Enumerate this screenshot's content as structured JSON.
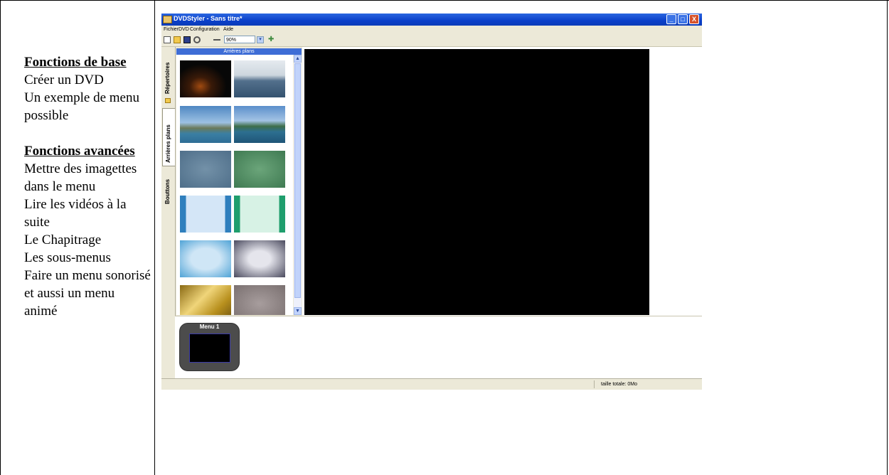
{
  "document": {
    "sections": [
      {
        "heading": "Fonctions de base",
        "items": [
          "Créer un DVD",
          "Un exemple de menu possible"
        ]
      },
      {
        "heading": "Fonctions avancées",
        "items": [
          "Mettre des imagettes dans le menu",
          "Lire les vidéos à la suite",
          "Le Chapitrage",
          "Les sous-menus",
          "Faire un menu sonorisé et aussi un menu animé"
        ]
      }
    ]
  },
  "window": {
    "title": "DVDStyler - Sans titre*",
    "controls": {
      "minimize": "_",
      "maximize": "□",
      "close": "X"
    }
  },
  "menubar": {
    "items": [
      "Fichier",
      "DVD",
      "Configuration",
      "Aide"
    ]
  },
  "toolbar": {
    "icons": [
      "new-icon",
      "open-icon",
      "save-icon",
      "settings-icon",
      "minus-icon",
      "zoom-in-icon"
    ],
    "zoom": "90%"
  },
  "side_tabs": [
    "Répertoires",
    "Arrières plans",
    "Bouttons"
  ],
  "panel": {
    "header": "Arrières plans",
    "thumbnails": [
      "night-scene",
      "sea-landscape",
      "coast-landscape",
      "bay-landscape",
      "blue-blur",
      "green-blur",
      "blue-stripes",
      "green-stripes",
      "blue-frame",
      "grey-frame",
      "gold-frame",
      "noise-texture"
    ]
  },
  "menus_strip": {
    "menu_label": "Menu 1"
  },
  "statusbar": {
    "total": "taille totale: 0Mo"
  },
  "colors": {
    "titlebar": "#0a3fc9",
    "panel_header": "#3e6dd6",
    "canvas": "#000000"
  }
}
